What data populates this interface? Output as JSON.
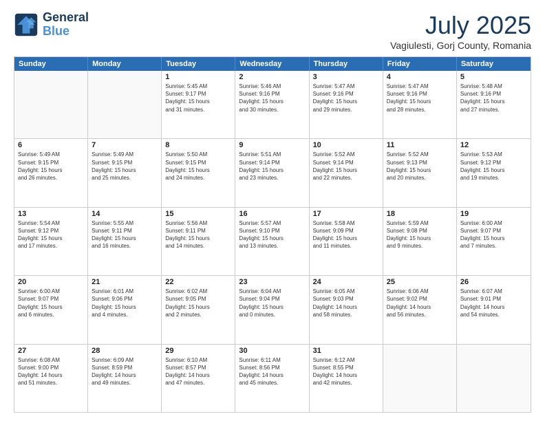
{
  "logo": {
    "line1": "General",
    "line2": "Blue"
  },
  "title": "July 2025",
  "subtitle": "Vagiulesti, Gorj County, Romania",
  "header_days": [
    "Sunday",
    "Monday",
    "Tuesday",
    "Wednesday",
    "Thursday",
    "Friday",
    "Saturday"
  ],
  "weeks": [
    [
      {
        "day": "",
        "text": ""
      },
      {
        "day": "",
        "text": ""
      },
      {
        "day": "1",
        "text": "Sunrise: 5:45 AM\nSunset: 9:17 PM\nDaylight: 15 hours\nand 31 minutes."
      },
      {
        "day": "2",
        "text": "Sunrise: 5:46 AM\nSunset: 9:16 PM\nDaylight: 15 hours\nand 30 minutes."
      },
      {
        "day": "3",
        "text": "Sunrise: 5:47 AM\nSunset: 9:16 PM\nDaylight: 15 hours\nand 29 minutes."
      },
      {
        "day": "4",
        "text": "Sunrise: 5:47 AM\nSunset: 9:16 PM\nDaylight: 15 hours\nand 28 minutes."
      },
      {
        "day": "5",
        "text": "Sunrise: 5:48 AM\nSunset: 9:16 PM\nDaylight: 15 hours\nand 27 minutes."
      }
    ],
    [
      {
        "day": "6",
        "text": "Sunrise: 5:49 AM\nSunset: 9:15 PM\nDaylight: 15 hours\nand 26 minutes."
      },
      {
        "day": "7",
        "text": "Sunrise: 5:49 AM\nSunset: 9:15 PM\nDaylight: 15 hours\nand 25 minutes."
      },
      {
        "day": "8",
        "text": "Sunrise: 5:50 AM\nSunset: 9:15 PM\nDaylight: 15 hours\nand 24 minutes."
      },
      {
        "day": "9",
        "text": "Sunrise: 5:51 AM\nSunset: 9:14 PM\nDaylight: 15 hours\nand 23 minutes."
      },
      {
        "day": "10",
        "text": "Sunrise: 5:52 AM\nSunset: 9:14 PM\nDaylight: 15 hours\nand 22 minutes."
      },
      {
        "day": "11",
        "text": "Sunrise: 5:52 AM\nSunset: 9:13 PM\nDaylight: 15 hours\nand 20 minutes."
      },
      {
        "day": "12",
        "text": "Sunrise: 5:53 AM\nSunset: 9:12 PM\nDaylight: 15 hours\nand 19 minutes."
      }
    ],
    [
      {
        "day": "13",
        "text": "Sunrise: 5:54 AM\nSunset: 9:12 PM\nDaylight: 15 hours\nand 17 minutes."
      },
      {
        "day": "14",
        "text": "Sunrise: 5:55 AM\nSunset: 9:11 PM\nDaylight: 15 hours\nand 16 minutes."
      },
      {
        "day": "15",
        "text": "Sunrise: 5:56 AM\nSunset: 9:11 PM\nDaylight: 15 hours\nand 14 minutes."
      },
      {
        "day": "16",
        "text": "Sunrise: 5:57 AM\nSunset: 9:10 PM\nDaylight: 15 hours\nand 13 minutes."
      },
      {
        "day": "17",
        "text": "Sunrise: 5:58 AM\nSunset: 9:09 PM\nDaylight: 15 hours\nand 11 minutes."
      },
      {
        "day": "18",
        "text": "Sunrise: 5:59 AM\nSunset: 9:08 PM\nDaylight: 15 hours\nand 9 minutes."
      },
      {
        "day": "19",
        "text": "Sunrise: 6:00 AM\nSunset: 9:07 PM\nDaylight: 15 hours\nand 7 minutes."
      }
    ],
    [
      {
        "day": "20",
        "text": "Sunrise: 6:00 AM\nSunset: 9:07 PM\nDaylight: 15 hours\nand 6 minutes."
      },
      {
        "day": "21",
        "text": "Sunrise: 6:01 AM\nSunset: 9:06 PM\nDaylight: 15 hours\nand 4 minutes."
      },
      {
        "day": "22",
        "text": "Sunrise: 6:02 AM\nSunset: 9:05 PM\nDaylight: 15 hours\nand 2 minutes."
      },
      {
        "day": "23",
        "text": "Sunrise: 6:04 AM\nSunset: 9:04 PM\nDaylight: 15 hours\nand 0 minutes."
      },
      {
        "day": "24",
        "text": "Sunrise: 6:05 AM\nSunset: 9:03 PM\nDaylight: 14 hours\nand 58 minutes."
      },
      {
        "day": "25",
        "text": "Sunrise: 6:06 AM\nSunset: 9:02 PM\nDaylight: 14 hours\nand 56 minutes."
      },
      {
        "day": "26",
        "text": "Sunrise: 6:07 AM\nSunset: 9:01 PM\nDaylight: 14 hours\nand 54 minutes."
      }
    ],
    [
      {
        "day": "27",
        "text": "Sunrise: 6:08 AM\nSunset: 9:00 PM\nDaylight: 14 hours\nand 51 minutes."
      },
      {
        "day": "28",
        "text": "Sunrise: 6:09 AM\nSunset: 8:59 PM\nDaylight: 14 hours\nand 49 minutes."
      },
      {
        "day": "29",
        "text": "Sunrise: 6:10 AM\nSunset: 8:57 PM\nDaylight: 14 hours\nand 47 minutes."
      },
      {
        "day": "30",
        "text": "Sunrise: 6:11 AM\nSunset: 8:56 PM\nDaylight: 14 hours\nand 45 minutes."
      },
      {
        "day": "31",
        "text": "Sunrise: 6:12 AM\nSunset: 8:55 PM\nDaylight: 14 hours\nand 42 minutes."
      },
      {
        "day": "",
        "text": ""
      },
      {
        "day": "",
        "text": ""
      }
    ]
  ]
}
